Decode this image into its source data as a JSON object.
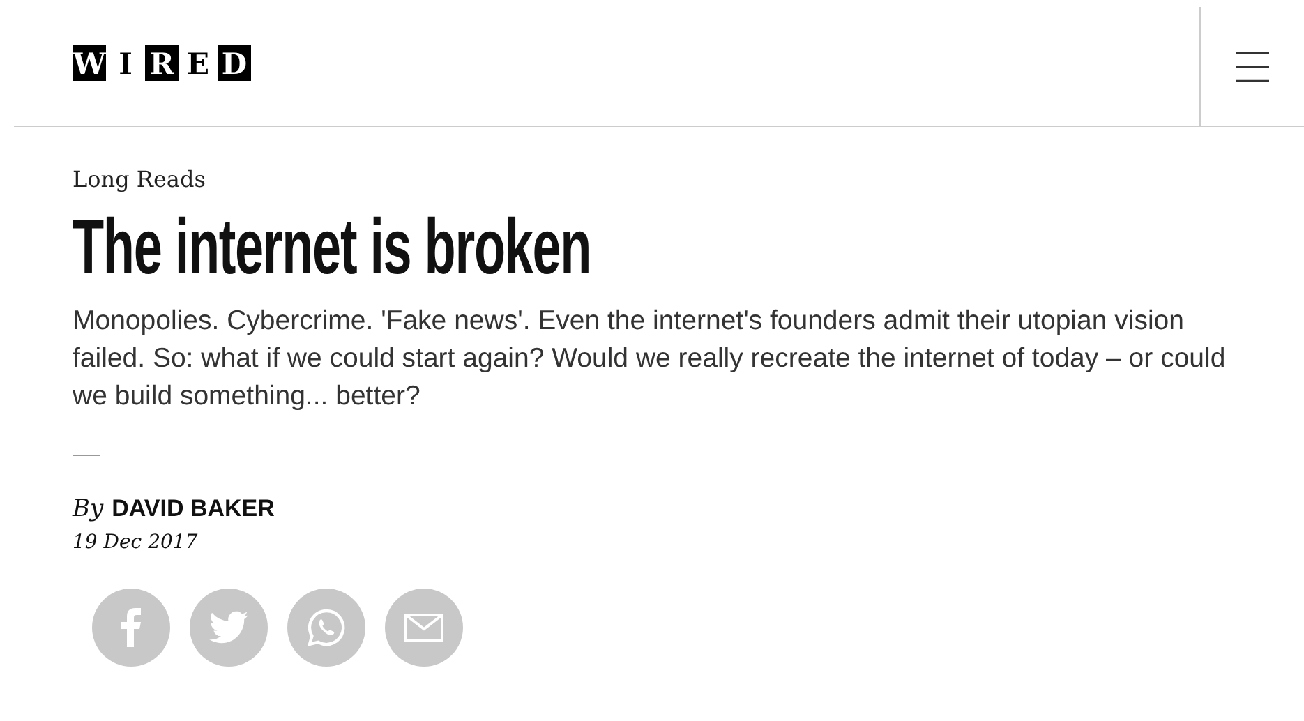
{
  "header": {
    "logo": [
      {
        "char": "W",
        "inverted": true
      },
      {
        "char": "I",
        "inverted": false
      },
      {
        "char": "R",
        "inverted": true
      },
      {
        "char": "E",
        "inverted": false
      },
      {
        "char": "D",
        "inverted": true
      }
    ]
  },
  "article": {
    "section": "Long Reads",
    "title": "The internet is broken",
    "standfirst": "Monopolies. Cybercrime. 'Fake news'. Even the internet's founders admit their utopian vision failed. So: what if we could start again? Would we really recreate the internet of today – or could we build something... better?",
    "byline_prefix": "By",
    "author": "DAVID BAKER",
    "date": "19 Dec 2017"
  },
  "share_buttons": [
    {
      "kind": "facebook"
    },
    {
      "kind": "twitter"
    },
    {
      "kind": "whatsapp"
    },
    {
      "kind": "email"
    }
  ]
}
